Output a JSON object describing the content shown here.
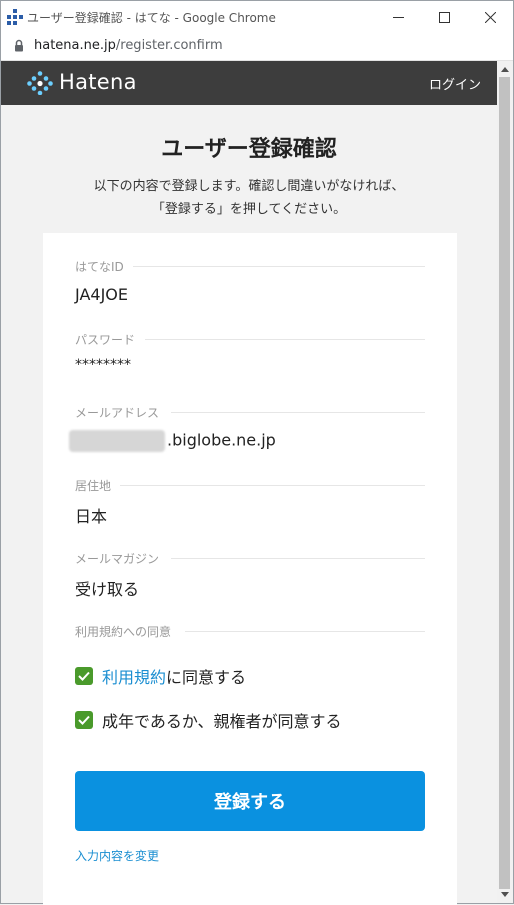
{
  "browser": {
    "window_title": "ユーザー登録確認 - はてな - Google Chrome",
    "url_host": "hatena.ne.jp",
    "url_path": "/register.confirm"
  },
  "header": {
    "logo_text": "Hatena",
    "login_label": "ログイン"
  },
  "page": {
    "title": "ユーザー登録確認",
    "description_line1": "以下の内容で登録します。確認し間違いがなければ、",
    "description_line2": "「登録する」を押してください。"
  },
  "fields": [
    {
      "label": "はてなID",
      "value": "JA4JOE"
    },
    {
      "label": "パスワード",
      "value": "********"
    },
    {
      "label": "メールアドレス",
      "value": ".biglobe.ne.jp"
    },
    {
      "label": "居住地",
      "value": "日本"
    },
    {
      "label": "メールマガジン",
      "value": "受け取る"
    }
  ],
  "agreement": {
    "label": "利用規約への同意",
    "terms_link": "利用規約",
    "terms_suffix": "に同意する",
    "age_text": "成年であるか、親権者が同意する"
  },
  "actions": {
    "submit_label": "登録する",
    "change_link": "入力内容を変更"
  },
  "colors": {
    "header_bg": "#3d3d3d",
    "primary_button": "#0a91e0",
    "link": "#1a8ed1",
    "checkbox": "#4a9a2b"
  }
}
